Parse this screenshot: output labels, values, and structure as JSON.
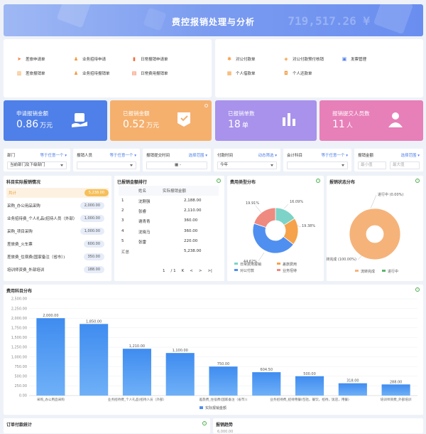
{
  "banner": {
    "title": "费控报销处理与分析",
    "amount": "719,517.26 ¥"
  },
  "quick_left": [
    {
      "label": "差旅申请单",
      "icon": "send-icon",
      "color": "#f47c3c"
    },
    {
      "label": "业务招待申请",
      "icon": "people-icon",
      "color": "#f29a3e"
    },
    {
      "label": "日常报销申请单",
      "icon": "bookmark-icon",
      "color": "#f26b3a"
    },
    {
      "label": "差旅报销单",
      "icon": "bar-chart-icon",
      "color": "#f29a3e"
    },
    {
      "label": "业务招待报销单",
      "icon": "people-icon",
      "color": "#f29a3e"
    },
    {
      "label": "日常费用报销单",
      "icon": "document-icon",
      "color": "#f26b3a"
    }
  ],
  "quick_right": [
    {
      "label": "对公付款单",
      "icon": "settings-icon",
      "color": "#f29a3e"
    },
    {
      "label": "对公付款预付核销",
      "icon": "tag-icon",
      "color": "#f29a3e"
    },
    {
      "label": "发票管理",
      "icon": "invoice-icon",
      "color": "#4f7fe8"
    },
    {
      "label": "个人借款单",
      "icon": "wallet-icon",
      "color": "#f29a3e"
    },
    {
      "label": "个人还款单",
      "icon": "box-icon",
      "color": "#f29a3e"
    }
  ],
  "kpis": [
    {
      "label": "申请报销金额",
      "value": "0.86",
      "unit": "万元",
      "icon": "hand-bag-icon",
      "color": "#4f7fe8"
    },
    {
      "label": "已报销金额",
      "value": "0.52",
      "unit": "万元",
      "icon": "certificate-icon",
      "color": "#f5b06e"
    },
    {
      "label": "已报销单数",
      "value": "18",
      "unit": "单",
      "icon": "bar-chart-icon",
      "color": "#a892ec"
    },
    {
      "label": "报销提交人员数",
      "value": "11",
      "unit": "人",
      "icon": "person-icon",
      "color": "#e77fb8"
    }
  ],
  "filters": [
    {
      "label": "部门",
      "mode": "等于任意一个",
      "value": "当前部门及下级部门",
      "placeholder": false
    },
    {
      "label": "报销人员",
      "mode": "等于任意一个",
      "value": "",
      "placeholder": false
    },
    {
      "label": "报销提交时间",
      "mode": "选择范围",
      "value": "-",
      "placeholder": false
    },
    {
      "label": "付款时间",
      "mode": "动态筛选",
      "value": "今年",
      "placeholder": false
    },
    {
      "label": "会计科目",
      "mode": "等于任意一个",
      "value": "",
      "placeholder": false
    },
    {
      "label": "报销金额",
      "mode": "选择范围",
      "min": "最小值",
      "max": "最大值"
    }
  ],
  "subject_panel": {
    "title": "科目实际报销情况",
    "rows": [
      {
        "name": "共计",
        "value": "5,238.00",
        "highlight": true
      },
      {
        "name": "采购_办公用品采购",
        "value": "2,000.00"
      },
      {
        "name": "业务招待费_个人礼品(招待人员（外部）",
        "value": "1,000.00"
      },
      {
        "name": "采购_项目采购",
        "value": "1,000.00"
      },
      {
        "name": "差旅费_火车票",
        "value": "600.00"
      },
      {
        "name": "差旅费_住宿费(国家备注（省市）)",
        "value": "350.00"
      },
      {
        "name": "培训师资费_外部培训",
        "value": "188.00"
      }
    ]
  },
  "rank_panel": {
    "title": "已报销金额排行",
    "headers": [
      "姓名",
      "实际报销金额"
    ],
    "rows": [
      {
        "idx": "1",
        "name": "沈刚强",
        "amount": "2,188.00"
      },
      {
        "idx": "2",
        "name": "张睿",
        "amount": "2,110.00"
      },
      {
        "idx": "3",
        "name": "谢青青",
        "amount": "360.00"
      },
      {
        "idx": "4",
        "name": "沈晓马",
        "amount": "360.00"
      },
      {
        "idx": "5",
        "name": "张雷",
        "amount": "220.00"
      }
    ],
    "total_label": "汇总",
    "total": "5,238.00",
    "pager": {
      "page": "1",
      "total": "/ 1",
      "first": "K",
      "prev": "<",
      "next": ">",
      "last": ">|"
    }
  },
  "type_panel": {
    "title": "费用类型分布"
  },
  "status_panel": {
    "title": "报销状态分布"
  },
  "bar_panel": {
    "title": "费用科目分布",
    "legend": "实际报销金额"
  },
  "bottom_left": {
    "title": "订单付款统计"
  },
  "bottom_right": {
    "title": "报销趋势",
    "first_tick": "6,000.00"
  },
  "chart_data": [
    {
      "type": "pie",
      "title": "费用类型分布",
      "labels": [
        "日常费用报销",
        "差旅费用",
        "对公付款",
        "业务招待"
      ],
      "values": [
        16.09,
        19.38,
        44.62,
        19.91
      ],
      "value_labels": [
        "16.09%",
        "19.38%",
        "44.62%",
        "19.91%"
      ],
      "colors": [
        "#7dd3c8",
        "#f5a24b",
        "#4f8ff0",
        "#ef8a80"
      ],
      "legend_position": "bottom"
    },
    {
      "type": "pie",
      "title": "报销状态分布",
      "labels": [
        "流转完成",
        "进行中"
      ],
      "values": [
        100.0,
        0.0
      ],
      "value_labels": [
        "流转完成 (100.00%)",
        "进行中 (0.00%)"
      ],
      "colors": [
        "#f5b37a",
        "#59b66b"
      ],
      "legend_position": "bottom"
    },
    {
      "type": "bar",
      "title": "费用科目分布",
      "categories": [
        "采购_办公用品采购",
        "",
        "业务招待费_个人礼品(招待人员（外部）",
        "",
        "差旅费_住宿费(国家备注（省市）)",
        "",
        "业务招待费_招待用餐(包括，餐饮，招待，饭店，用餐)",
        "",
        "培训师资费_外部培训"
      ],
      "series": [
        {
          "name": "实际报销金额",
          "values": [
            2000,
            1850,
            1210,
            1100,
            750,
            604.5,
            500,
            318,
            288
          ]
        }
      ],
      "value_labels": [
        "2,000.00",
        "1,850.00",
        "1,210.00",
        "1,100.00",
        "750.00",
        "604.50",
        "500.00",
        "318.00",
        "288.00"
      ],
      "y_ticks": [
        "0.00",
        "250.00",
        "500.00",
        "750.00",
        "1,000.00",
        "1,250.00",
        "1,500.00",
        "1,750.00",
        "2,000.00",
        "2,250.00",
        "2,500.00"
      ],
      "ylim": [
        0,
        2500
      ],
      "grid": true,
      "legend_position": "bottom"
    }
  ]
}
